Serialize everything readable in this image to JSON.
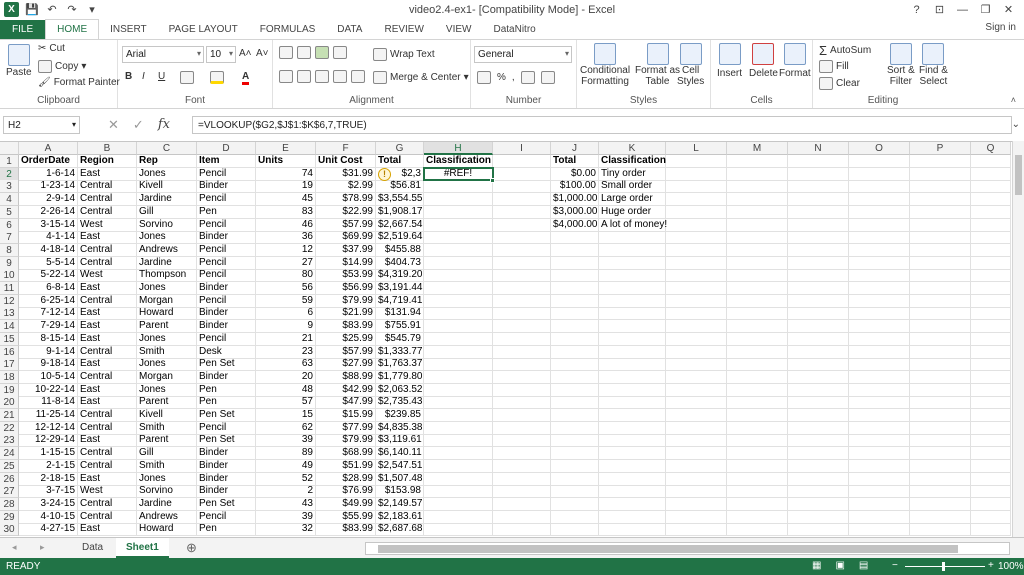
{
  "window": {
    "title": "video2.4-ex1-  [Compatibility Mode] - Excel",
    "help": "?",
    "restore_ribbon": "⊡",
    "minimize": "—",
    "maximize": "❐",
    "close": "✕"
  },
  "qat": {
    "logo": "X",
    "save": "💾",
    "undo": "↶",
    "redo": "↷",
    "customize": "▾"
  },
  "tabs": [
    "FILE",
    "HOME",
    "INSERT",
    "PAGE LAYOUT",
    "FORMULAS",
    "DATA",
    "REVIEW",
    "VIEW",
    "DataNitro"
  ],
  "signin": "Sign in",
  "ribbon": {
    "clipboard": {
      "label": "Clipboard",
      "paste": "Paste",
      "cut": "Cut",
      "copy": "Copy",
      "copy_dd": "▾",
      "format_painter": "Format Painter"
    },
    "font": {
      "label": "Font",
      "name": "Arial",
      "size": "10",
      "grow": "A˄",
      "shrink": "A˅",
      "bold": "B",
      "italic": "I",
      "underline": "U"
    },
    "alignment": {
      "label": "Alignment",
      "wrap": "Wrap Text",
      "merge": "Merge & Center"
    },
    "number": {
      "label": "Number",
      "format": "General",
      "percent": "%",
      "comma": ","
    },
    "styles": {
      "label": "Styles",
      "conditional": "Conditional",
      "conditional2": "Formatting",
      "format_as": "Format as",
      "format_as2": "Table",
      "cell": "Cell",
      "cell2": "Styles"
    },
    "cells": {
      "label": "Cells",
      "insert": "Insert",
      "delete": "Delete",
      "format": "Format"
    },
    "editing": {
      "label": "Editing",
      "autosum": "AutoSum",
      "fill": "Fill",
      "clear": "Clear",
      "sort": "Sort &",
      "sort2": "Filter",
      "find": "Find &",
      "find2": "Select"
    }
  },
  "formula_bar": {
    "name_box": "H2",
    "formula": "=VLOOKUP($G2,$J$1:$K$6,7,TRUE)"
  },
  "columns": [
    "A",
    "B",
    "C",
    "D",
    "E",
    "F",
    "G",
    "H",
    "I",
    "J",
    "K",
    "L",
    "M",
    "N",
    "O",
    "P",
    "Q"
  ],
  "rows": [
    [
      "OrderDate",
      "Region",
      "Rep",
      "Item",
      "Units",
      "Unit Cost",
      "Total",
      "Classification",
      "",
      "Total",
      "Classification"
    ],
    [
      "1-6-14",
      "East",
      "Jones",
      "Pencil",
      "74",
      "$31.99",
      "$2,3",
      "#REF!",
      "",
      "$0.00",
      "Tiny order"
    ],
    [
      "1-23-14",
      "Central",
      "Kivell",
      "Binder",
      "19",
      "$2.99",
      "$56.81",
      "",
      "",
      "$100.00",
      "Small order"
    ],
    [
      "2-9-14",
      "Central",
      "Jardine",
      "Pencil",
      "45",
      "$78.99",
      "$3,554.55",
      "",
      "",
      "$1,000.00",
      "Large order"
    ],
    [
      "2-26-14",
      "Central",
      "Gill",
      "Pen",
      "83",
      "$22.99",
      "$1,908.17",
      "",
      "",
      "$3,000.00",
      "Huge order"
    ],
    [
      "3-15-14",
      "West",
      "Sorvino",
      "Pencil",
      "46",
      "$57.99",
      "$2,667.54",
      "",
      "",
      "$4,000.00",
      "A lot of money!"
    ],
    [
      "4-1-14",
      "East",
      "Jones",
      "Binder",
      "36",
      "$69.99",
      "$2,519.64",
      "",
      "",
      "",
      ""
    ],
    [
      "4-18-14",
      "Central",
      "Andrews",
      "Pencil",
      "12",
      "$37.99",
      "$455.88",
      "",
      "",
      "",
      ""
    ],
    [
      "5-5-14",
      "Central",
      "Jardine",
      "Pencil",
      "27",
      "$14.99",
      "$404.73",
      "",
      "",
      "",
      ""
    ],
    [
      "5-22-14",
      "West",
      "Thompson",
      "Pencil",
      "80",
      "$53.99",
      "$4,319.20",
      "",
      "",
      "",
      ""
    ],
    [
      "6-8-14",
      "East",
      "Jones",
      "Binder",
      "56",
      "$56.99",
      "$3,191.44",
      "",
      "",
      "",
      ""
    ],
    [
      "6-25-14",
      "Central",
      "Morgan",
      "Pencil",
      "59",
      "$79.99",
      "$4,719.41",
      "",
      "",
      "",
      ""
    ],
    [
      "7-12-14",
      "East",
      "Howard",
      "Binder",
      "6",
      "$21.99",
      "$131.94",
      "",
      "",
      "",
      ""
    ],
    [
      "7-29-14",
      "East",
      "Parent",
      "Binder",
      "9",
      "$83.99",
      "$755.91",
      "",
      "",
      "",
      ""
    ],
    [
      "8-15-14",
      "East",
      "Jones",
      "Pencil",
      "21",
      "$25.99",
      "$545.79",
      "",
      "",
      "",
      ""
    ],
    [
      "9-1-14",
      "Central",
      "Smith",
      "Desk",
      "23",
      "$57.99",
      "$1,333.77",
      "",
      "",
      "",
      ""
    ],
    [
      "9-18-14",
      "East",
      "Jones",
      "Pen Set",
      "63",
      "$27.99",
      "$1,763.37",
      "",
      "",
      "",
      ""
    ],
    [
      "10-5-14",
      "Central",
      "Morgan",
      "Binder",
      "20",
      "$88.99",
      "$1,779.80",
      "",
      "",
      "",
      ""
    ],
    [
      "10-22-14",
      "East",
      "Jones",
      "Pen",
      "48",
      "$42.99",
      "$2,063.52",
      "",
      "",
      "",
      ""
    ],
    [
      "11-8-14",
      "East",
      "Parent",
      "Pen",
      "57",
      "$47.99",
      "$2,735.43",
      "",
      "",
      "",
      ""
    ],
    [
      "11-25-14",
      "Central",
      "Kivell",
      "Pen Set",
      "15",
      "$15.99",
      "$239.85",
      "",
      "",
      "",
      ""
    ],
    [
      "12-12-14",
      "Central",
      "Smith",
      "Pencil",
      "62",
      "$77.99",
      "$4,835.38",
      "",
      "",
      "",
      ""
    ],
    [
      "12-29-14",
      "East",
      "Parent",
      "Pen Set",
      "39",
      "$79.99",
      "$3,119.61",
      "",
      "",
      "",
      ""
    ],
    [
      "1-15-15",
      "Central",
      "Gill",
      "Binder",
      "89",
      "$68.99",
      "$6,140.11",
      "",
      "",
      "",
      ""
    ],
    [
      "2-1-15",
      "Central",
      "Smith",
      "Binder",
      "49",
      "$51.99",
      "$2,547.51",
      "",
      "",
      "",
      ""
    ],
    [
      "2-18-15",
      "East",
      "Jones",
      "Binder",
      "52",
      "$28.99",
      "$1,507.48",
      "",
      "",
      "",
      ""
    ],
    [
      "3-7-15",
      "West",
      "Sorvino",
      "Binder",
      "2",
      "$76.99",
      "$153.98",
      "",
      "",
      "",
      ""
    ],
    [
      "3-24-15",
      "Central",
      "Jardine",
      "Pen Set",
      "43",
      "$49.99",
      "$2,149.57",
      "",
      "",
      "",
      ""
    ],
    [
      "4-10-15",
      "Central",
      "Andrews",
      "Pencil",
      "39",
      "$55.99",
      "$2,183.61",
      "",
      "",
      "",
      ""
    ],
    [
      "4-27-15",
      "East",
      "Howard",
      "Pen",
      "32",
      "$83.99",
      "$2,687.68",
      "",
      "",
      "",
      ""
    ]
  ],
  "error_badge": "!",
  "sheets": [
    "Data",
    "Sheet1"
  ],
  "active_sheet": "Sheet1",
  "add_sheet": "⊕",
  "status": {
    "text": "READY",
    "zoom": "100%",
    "zoom_minus": "−",
    "zoom_plus": "+"
  },
  "colors": {
    "accent": "#217346",
    "header_bg": "#f3f3f3"
  }
}
